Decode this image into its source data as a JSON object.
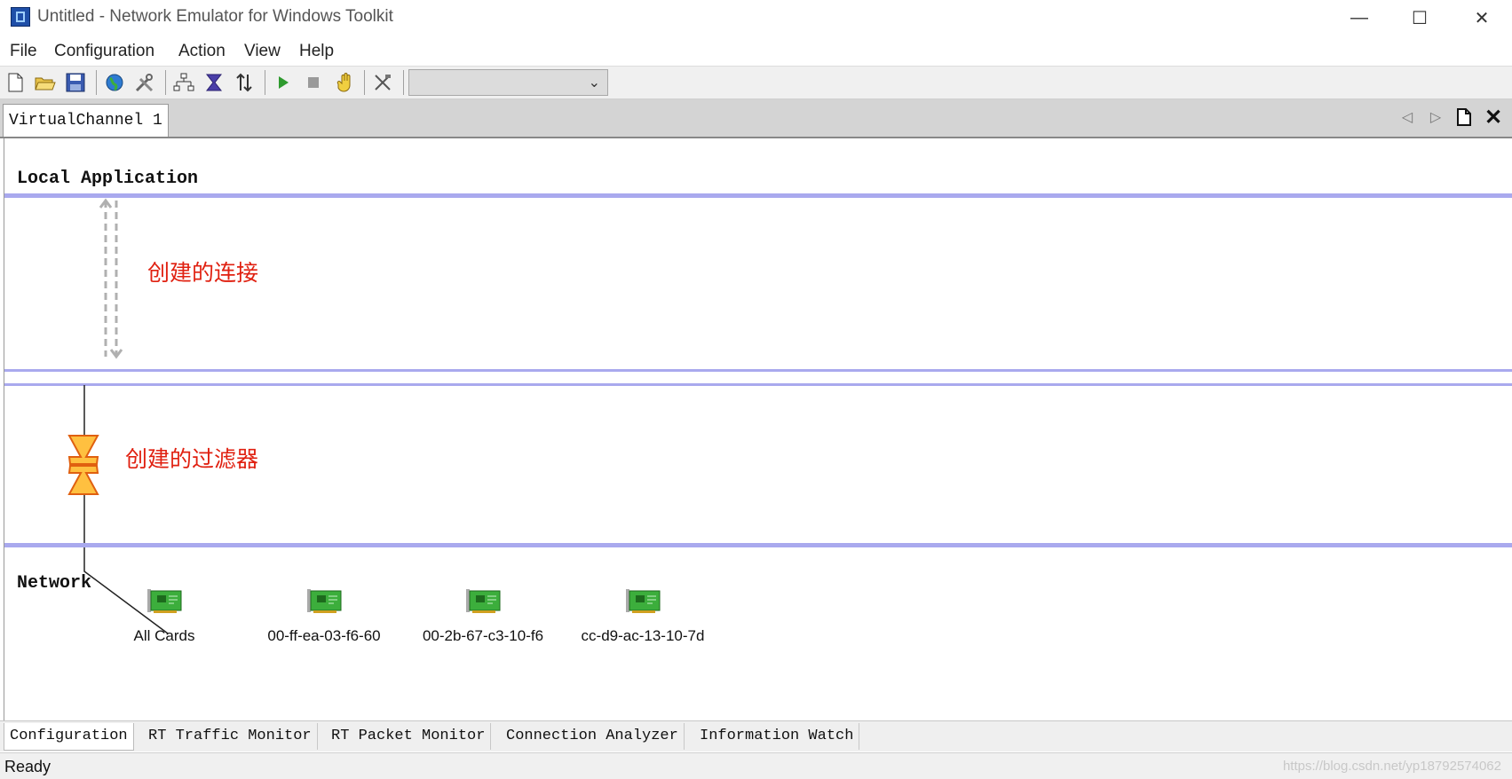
{
  "window": {
    "title": "Untitled - Network Emulator for Windows Toolkit",
    "minimize_glyph": "—",
    "maximize_glyph": "☐",
    "close_glyph": "✕"
  },
  "menu": {
    "items": [
      "File",
      "Configuration",
      "Action",
      "View",
      "Help"
    ]
  },
  "toolbar": {
    "buttons": [
      "new-file-icon",
      "open-folder-icon",
      "save-icon",
      "globe-icon",
      "tools-icon",
      "network-topology-icon",
      "filter-icon",
      "sort-arrows-icon",
      "play-icon",
      "stop-icon",
      "hand-icon",
      "disconnect-icon"
    ],
    "combo_value": ""
  },
  "document_tabs": {
    "active": "VirtualChannel 1",
    "controls": [
      "left-arrow-icon",
      "right-arrow-icon",
      "new-page-icon",
      "close-icon"
    ]
  },
  "canvas": {
    "local_application_label": "Local Application",
    "network_label": "Network",
    "connection_annotation": "创建的连接",
    "filter_annotation": "创建的过滤器",
    "cards": [
      "All Cards",
      "00-ff-ea-03-f6-60",
      "00-2b-67-c3-10-f6",
      "cc-d9-ac-13-10-7d"
    ],
    "colors": {
      "divider": "#a9a9ee",
      "annotation": "#e02010",
      "card": "#3cae3c",
      "filter": "#ffb020"
    }
  },
  "bottom_tabs": {
    "items": [
      "Configuration",
      "RT Traffic Monitor",
      "RT Packet Monitor",
      "Connection Analyzer",
      "Information Watch"
    ],
    "active": "Configuration"
  },
  "status": {
    "text": "Ready",
    "watermark": "https://blog.csdn.net/yp18792574062"
  }
}
